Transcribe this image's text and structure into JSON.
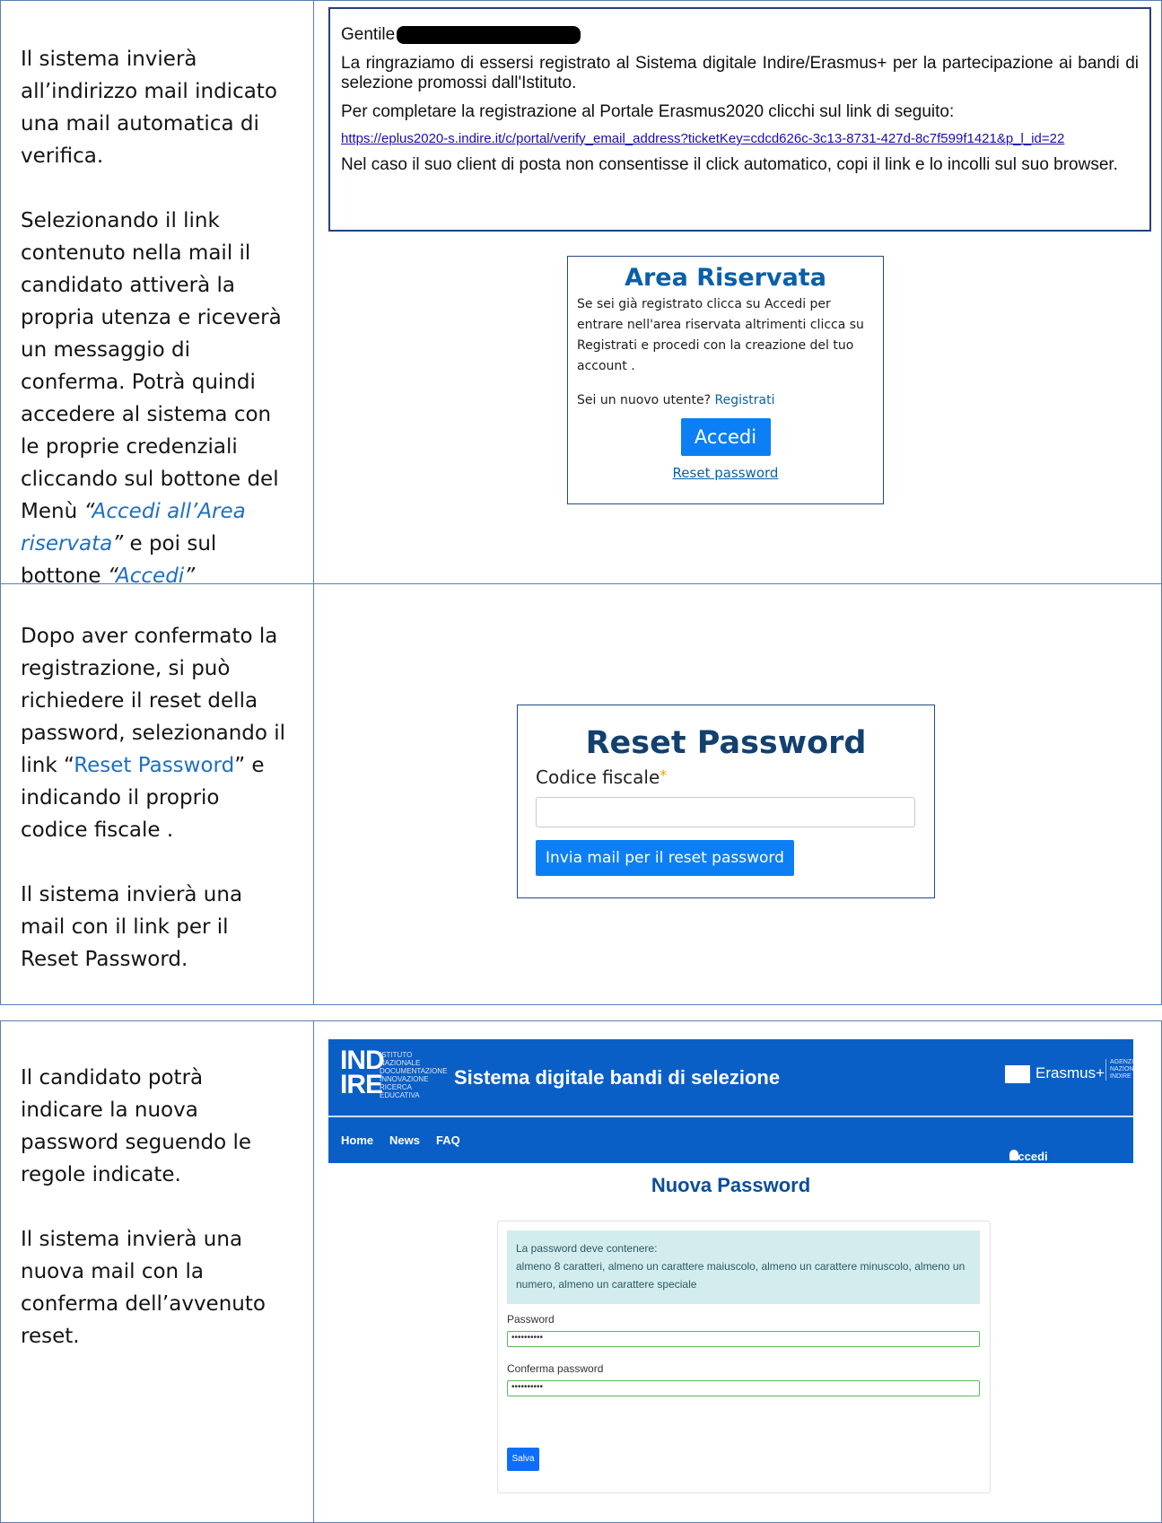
{
  "row1": {
    "left_para1": "Il sistema invierà all’indirizzo mail indicato una mail automatica di verifica.",
    "left_para2_prefix": "Selezionando il link contenuto nella mail il candidato attiverà la propria utenza e riceverà un messaggio di conferma. Potrà quindi accedere al sistema con le proprie credenziali cliccando sul bottone del Menù",
    "left_para2_q_open": "“",
    "left_para2_link1": "Accedi all’Area riservata",
    "left_para2_q_close": "”",
    "left_para2_mid": "e poi sul bottone",
    "left_para2_q_open2": "“",
    "left_para2_link2": "Accedi",
    "left_para2_q_close2": "”",
    "email": {
      "greeting": "Gentile",
      "line1": "La ringraziamo di essersi registrato al Sistema digitale Indire/Erasmus+ per la partecipazione ai bandi di selezione promossi dall'Istituto.",
      "line2": "Per completare la registrazione al Portale Erasmus2020 clicchi sul link di seguito:",
      "link": "https://eplus2020-s.indire.it/c/portal/verify_email_address?ticketKey=cdcd626c-3c13-8731-427d-8c7f599f1421&p_l_id=22",
      "line3": "Nel caso il suo client di posta non consentisse il click automatico, copi il link e lo incolli sul suo browser."
    },
    "area": {
      "title": "Area Riservata",
      "description": "Se sei già registrato clicca su Accedi per entrare nell'area riservata altrimenti clicca su Registrati e procedi con la creazione del tuo account .",
      "new_user_prefix": "Sei un nuovo utente?",
      "register_link": "Registrati",
      "login_button": "Accedi",
      "reset_link": "Reset password"
    }
  },
  "row2": {
    "left_a": "Dopo aver confermato la registrazione, si può richiedere il reset della password, selezionando il link “",
    "left_link": "Reset Password",
    "left_b": "” e indicando il proprio codice fiscale .",
    "left_para2": "Il sistema invierà una mail con il link per il Reset Password.",
    "reset": {
      "title": "Reset Password",
      "field_label": "Codice fiscale",
      "required_mark": "*",
      "submit_button": "Invia mail per il reset password"
    }
  },
  "row3": {
    "left_para1": "Il candidato potrà indicare la nuova password seguendo le regole indicate.",
    "left_para2": "Il sistema invierà una nuova mail con la conferma dell’avvenuto reset.",
    "portal": {
      "logo_top": "IND",
      "logo_bottom": "IRE",
      "logo_subtitle": "ISTITUTO NAZIONALE DOCUMENTAZIONE INNOVAZIONE RICERCA EDUCATIVA",
      "system_name": "Sistema digitale bandi di selezione",
      "erasmus": "Erasmus+",
      "agenzia": "AGENZIA NAZIONALE INDIRE",
      "nav_home": "Home",
      "nav_news": "News",
      "nav_faq": "FAQ",
      "nav_login": "Accedi all'area riserva",
      "page_title": "Nuova Password",
      "info_title": "La password deve contenere:",
      "info_rules": "almeno 8 caratteri, almeno un carattere maiuscolo, almeno un carattere minuscolo, almeno un numero, almeno un carattere speciale",
      "password_label": "Password",
      "password_value": "••••••••••",
      "confirm_label": "Conferma password",
      "confirm_value": "••••••••••",
      "save_button": "Salva"
    }
  }
}
